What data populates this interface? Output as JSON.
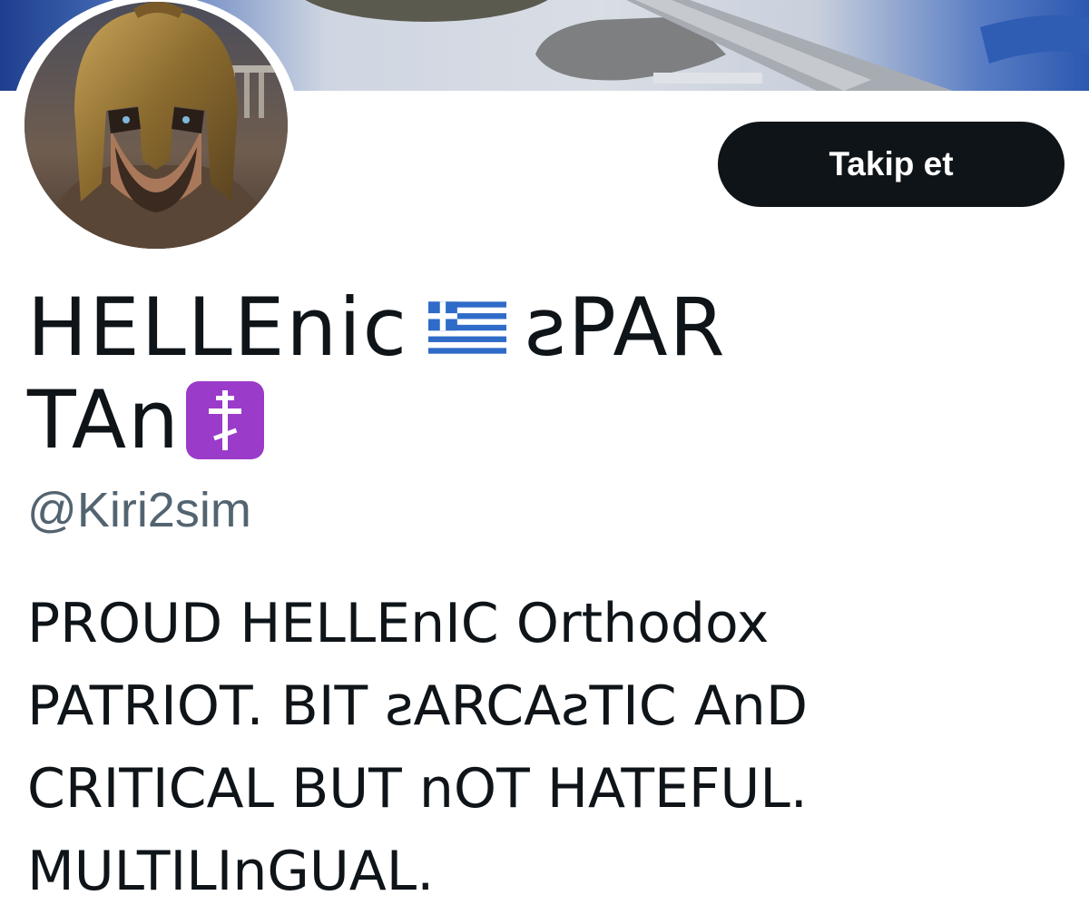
{
  "profile": {
    "display_name_line1": "HELLEnic",
    "display_name_line1b": "ƨPAR",
    "display_name_line2": "TAn",
    "flag_icon": "greece-flag-icon",
    "cross_icon": "orthodox-cross-icon",
    "handle": "@Kiri2sim",
    "follow_label": "Takip et",
    "bio_lines": [
      "PROUD HELLEnIC Orthodox",
      "PATRIOT. BIT ƨARCAƨTIC AnD",
      "CRITICAL BUT nOT HATEFUL.",
      "MULTILInGUAL."
    ]
  },
  "colors": {
    "text": "#0f1419",
    "handle": "#536471",
    "button_bg": "#0f1419",
    "button_text": "#ffffff",
    "cross_bg": "#9b3bc9"
  }
}
